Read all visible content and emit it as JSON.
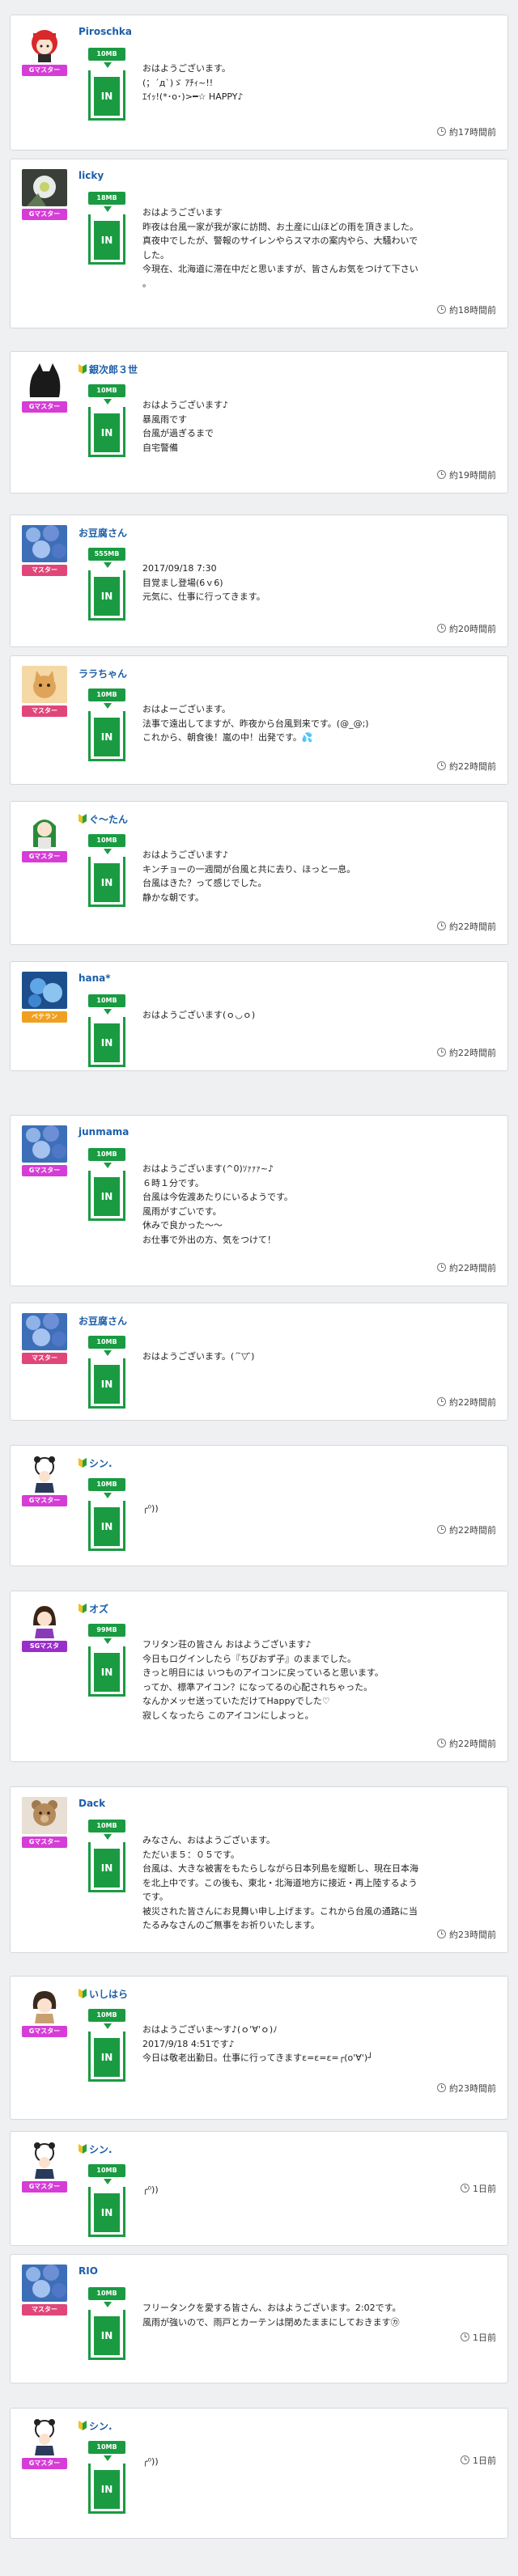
{
  "colors": {
    "g_master": "#d63cd6",
    "master": "#e0467a",
    "veteran": "#f0a020",
    "sg_master": "#9a2ec8",
    "badge_green": "#1a9b42",
    "name_blue": "#1d5fa8"
  },
  "posts": [
    {
      "user": "Piroschka",
      "beginner": false,
      "rank": "Gマスター",
      "rank_color": "#d63cd6",
      "badge": "10MB",
      "in": "IN",
      "lines": [
        "おはようございます。",
        "(；´д`)ゞ ｱﾁｨ~!!",
        "ｴｲｯ!(*･o･)>━☆ HAPPY♪"
      ],
      "time": "約17時間前",
      "avatar_icon": "anime-girl-avatar-icon"
    },
    {
      "user": "licky",
      "beginner": false,
      "rank": "Gマスター",
      "rank_color": "#d63cd6",
      "badge": "18MB",
      "in": "IN",
      "lines": [
        "おはようございます",
        "昨夜は台風一家が我が家に訪問、お土産に山ほどの雨を頂きました。",
        "真夜中でしたが、警報のサイレンやらスマホの案内やら、大騒わいで",
        "した。",
        "今現在、北海道に滞在中だと思いますが、皆さんお気をつけて下さい",
        "。"
      ],
      "time": "約18時間前",
      "avatar_icon": "flower-photo-avatar-icon"
    },
    {
      "user": "銀次郎３世",
      "beginner": true,
      "rank": "Gマスター",
      "rank_color": "#d63cd6",
      "badge": "10MB",
      "in": "IN",
      "lines": [
        "おはようございます♪",
        "暴風雨です",
        "台風が過ぎるまで",
        "自宅警備"
      ],
      "time": "約19時間前",
      "avatar_icon": "fox-silhouette-avatar-icon"
    },
    {
      "user": "お豆腐さん",
      "beginner": false,
      "rank": "マスター",
      "rank_color": "#e0467a",
      "badge": "555MB",
      "in": "IN",
      "lines": [
        "2017/09/18 7:30",
        "目覚まし登場(6ｖ6)",
        "元気に、仕事に行ってきます。"
      ],
      "time": "約20時間前",
      "avatar_icon": "hydrangea-photo-avatar-icon"
    },
    {
      "user": "ララちゃん",
      "beginner": false,
      "rank": "マスター",
      "rank_color": "#e0467a",
      "badge": "10MB",
      "in": "IN",
      "lines": [
        "おはよーございます。",
        "法事で遠出してますが、昨夜から台風到来です。(@_@;)",
        "これから、朝食後！嵐の中！出発です。💦"
      ],
      "time": "約22時間前",
      "avatar_icon": "cat-photo-avatar-icon"
    },
    {
      "user": "ぐ〜たん",
      "beginner": true,
      "rank": "Gマスター",
      "rank_color": "#d63cd6",
      "badge": "10MB",
      "in": "IN",
      "lines": [
        "おはようございます♪",
        "キンチョーの一週間が台風と共に去り、ほっと一息。",
        "台風はきた？って感じでした。",
        "静かな朝です。"
      ],
      "time": "約22時間前",
      "avatar_icon": "green-hair-girl-avatar-icon"
    },
    {
      "user": "hana*",
      "beginner": false,
      "rank": "ベテラン",
      "rank_color": "#f0a020",
      "badge": "10MB",
      "in": "IN",
      "lines": [
        "おはようございます(ｏ◡ｏ)"
      ],
      "time": "約22時間前",
      "avatar_icon": "blue-flower-avatar-icon"
    },
    {
      "user": "junmama",
      "beginner": false,
      "rank": "Gマスター",
      "rank_color": "#d63cd6",
      "badge": "10MB",
      "in": "IN",
      "lines": [
        "おはようございます(^0)ｿｧｧｧ~♪",
        "６時１分です。",
        "台風は今佐渡あたりにいるようです。",
        "風雨がすごいです。",
        "休みで良かった～～",
        "お仕事で外出の方、気をつけて！"
      ],
      "time": "約22時間前",
      "avatar_icon": "hydrangea-photo-avatar-icon"
    },
    {
      "user": "お豆腐さん",
      "beginner": false,
      "rank": "マスター",
      "rank_color": "#e0467a",
      "badge": "10MB",
      "in": "IN",
      "lines": [
        "おはようございます。(´ ̄▽ ̄)"
      ],
      "time": "約22時間前",
      "avatar_icon": "hydrangea-photo-avatar-icon"
    },
    {
      "user": "シン.",
      "beginner": true,
      "rank": "Gマスター",
      "rank_color": "#d63cd6",
      "badge": "10MB",
      "in": "IN",
      "lines": [
        "╭⁰))"
      ],
      "time": "約22時間前",
      "avatar_icon": "panda-boy-avatar-icon"
    },
    {
      "user": "オズ",
      "beginner": true,
      "rank": "SGマスタ",
      "rank_color": "#9a2ec8",
      "badge": "99MB",
      "in": "IN",
      "lines": [
        "フリタン荘の皆さん おはようございます♪",
        "今日もログインしたら『ちびおず子』のままでした。",
        "きっと明日には いつものアイコンに戻っていると思います。",
        "ってか、標準アイコン？になってるの心配されちゃった。",
        "なんかメッセ送っていただけてHappyでした♡",
        "寂しくなったら このアイコンにしよっと。"
      ],
      "time": "約22時間前",
      "avatar_icon": "girl-purple-avatar-icon"
    },
    {
      "user": "Dack",
      "beginner": false,
      "rank": "Gマスター",
      "rank_color": "#d63cd6",
      "badge": "10MB",
      "in": "IN",
      "lines": [
        "みなさん、おはようございます。",
        "ただいま５：０５です。",
        "台風は、大きな被害をもたらしながら日本列島を縦断し、現在日本海",
        "を北上中です。この後も、東北・北海道地方に接近・再上陸するよう",
        "です。",
        "被災された皆さんにお見舞い申し上げます。これから台風の通路に当",
        "たるみなさんのご無事をお祈りいたします。"
      ],
      "time": "約23時間前",
      "avatar_icon": "teddy-bear-avatar-icon"
    },
    {
      "user": "いしはら",
      "beginner": true,
      "rank": "Gマスター",
      "rank_color": "#d63cd6",
      "badge": "10MB",
      "in": "IN",
      "lines": [
        "おはようございま～す♪(ｏ'∀'ｏ)ﾉ",
        "2017/9/18 4:51です♪",
        "今日は敬老出勤日。仕事に行ってきますε=ε=ε=┌(o'∀')┘"
      ],
      "time": "約23時間前",
      "avatar_icon": "anime-boy-avatar-icon"
    },
    {
      "user": "シン.",
      "beginner": true,
      "rank": "Gマスター",
      "rank_color": "#d63cd6",
      "badge": "10MB",
      "in": "IN",
      "lines": [
        "╭⁰))"
      ],
      "time": "1日前",
      "avatar_icon": "panda-boy-avatar-icon"
    },
    {
      "user": "RIO",
      "beginner": false,
      "rank": "マスター",
      "rank_color": "#e0467a",
      "badge": "10MB",
      "in": "IN",
      "lines": [
        "フリータンクを愛する皆さん、おはようございます。2:02です。",
        "風雨が強いので、雨戸とカーテンは閉めたままにしておきます㋕"
      ],
      "time": "1日前",
      "avatar_icon": "hydrangea-photo-avatar-icon"
    },
    {
      "user": "シン.",
      "beginner": true,
      "rank": "Gマスター",
      "rank_color": "#d63cd6",
      "badge": "10MB",
      "in": "IN",
      "lines": [
        "╭⁰))"
      ],
      "time": "1日前",
      "avatar_icon": "panda-boy-avatar-icon"
    }
  ]
}
